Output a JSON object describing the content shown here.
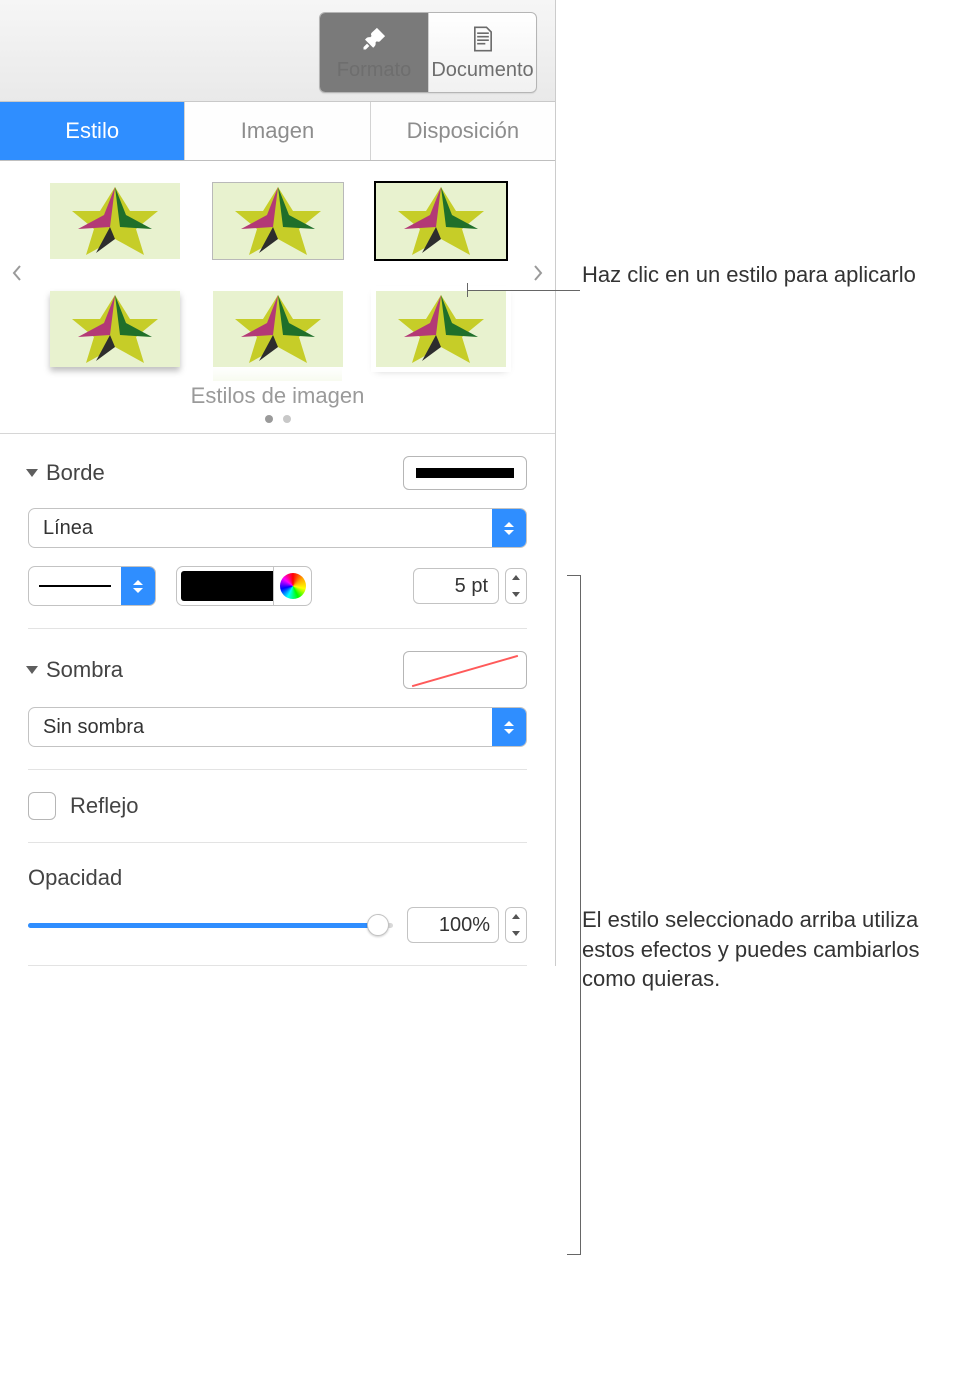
{
  "toolbar": {
    "format": "Formato",
    "document": "Documento"
  },
  "tabs": {
    "style": "Estilo",
    "image": "Imagen",
    "layout": "Disposición"
  },
  "gallery": {
    "label": "Estilos de imagen"
  },
  "border": {
    "title": "Borde",
    "line_type": "Línea",
    "width_value": "5 pt"
  },
  "shadow": {
    "title": "Sombra",
    "type": "Sin sombra"
  },
  "reflection": {
    "label": "Reflejo"
  },
  "opacity": {
    "label": "Opacidad",
    "value": "100%"
  },
  "callouts": {
    "styles": "Haz clic en un estilo para aplicarlo",
    "effects": "El estilo seleccionado arriba utiliza estos efectos y puedes cambiarlos como quieras."
  }
}
